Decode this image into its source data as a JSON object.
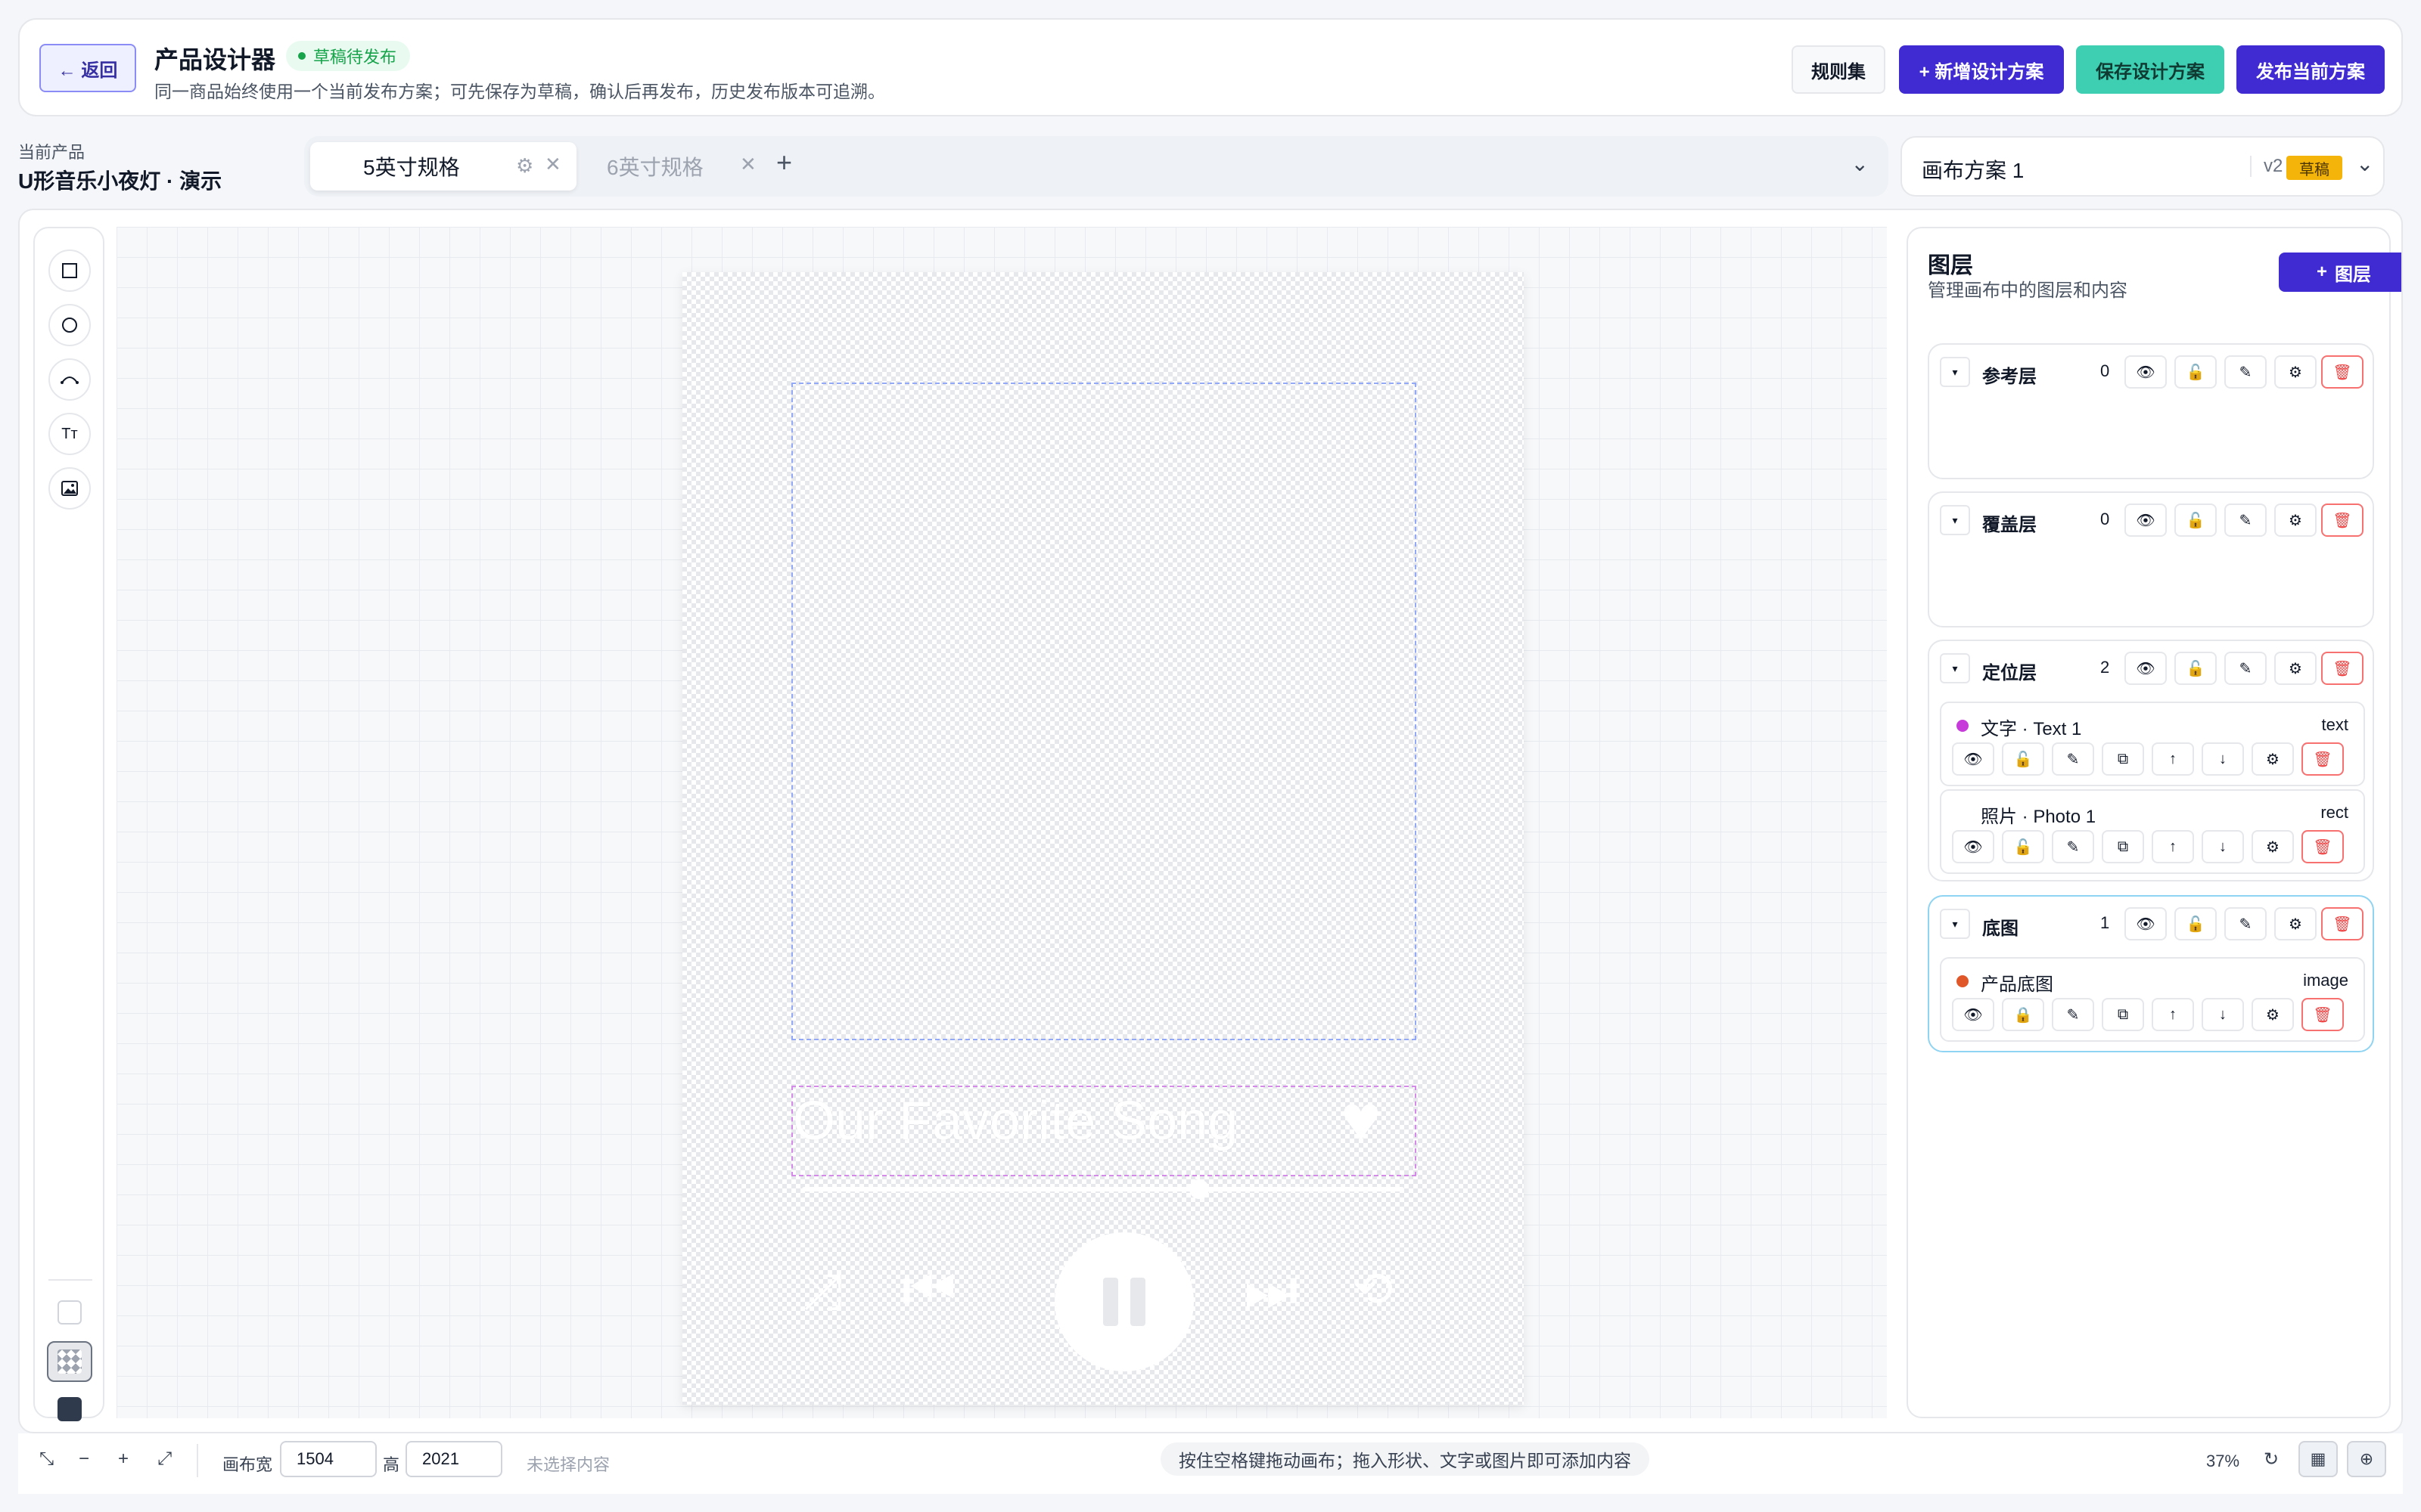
{
  "header": {
    "back_label": "← 返回",
    "title": "产品设计器",
    "status_badge": "草稿待发布",
    "subtitle": "同一商品始终使用一个当前发布方案；可先保存为草稿，确认后再发布，历史发布版本可追溯。",
    "rules_label": "规则集",
    "add_label": "+ 新增设计方案",
    "save_label": "保存设计方案",
    "publish_label": "发布当前方案"
  },
  "product": {
    "label": "当前产品",
    "name": "U形音乐小夜灯 · 演示"
  },
  "tabs": [
    {
      "label": "5英寸规格",
      "active": true
    },
    {
      "label": "6英寸规格",
      "active": false
    }
  ],
  "scheme": {
    "name": "画布方案 1",
    "version": "v2",
    "status": "草稿"
  },
  "canvas": {
    "song_title": "Our Favorite Song",
    "progress": 0.66
  },
  "layers_panel": {
    "title": "图层",
    "subtitle": "管理画布中的图层和内容",
    "add_label": "图层",
    "groups": [
      {
        "name": "参考层",
        "count": "0",
        "items": []
      },
      {
        "name": "覆盖层",
        "count": "0",
        "items": []
      },
      {
        "name": "定位层",
        "count": "2",
        "items": [
          {
            "name": "文字 · Text 1",
            "type": "text",
            "color": "#c63bd9"
          },
          {
            "name": "照片 · Photo 1",
            "type": "rect",
            "color": ""
          }
        ]
      },
      {
        "name": "底图",
        "count": "1",
        "items": [
          {
            "name": "产品底图",
            "type": "image",
            "color": "#e0572a"
          }
        ]
      }
    ]
  },
  "bottom": {
    "width_label": "画布宽",
    "width_value": "1504",
    "height_label": "高",
    "height_value": "2021",
    "selection": "未选择内容",
    "hint": "按住空格键拖动画布；拖入形状、文字或图片即可添加内容",
    "zoom": "37%"
  },
  "colors": {
    "primary": "#3f2bd1",
    "accent": "#3ecfb3",
    "draft": "#f5b40a",
    "success": "#16a34a",
    "danger": "#ef4444"
  }
}
